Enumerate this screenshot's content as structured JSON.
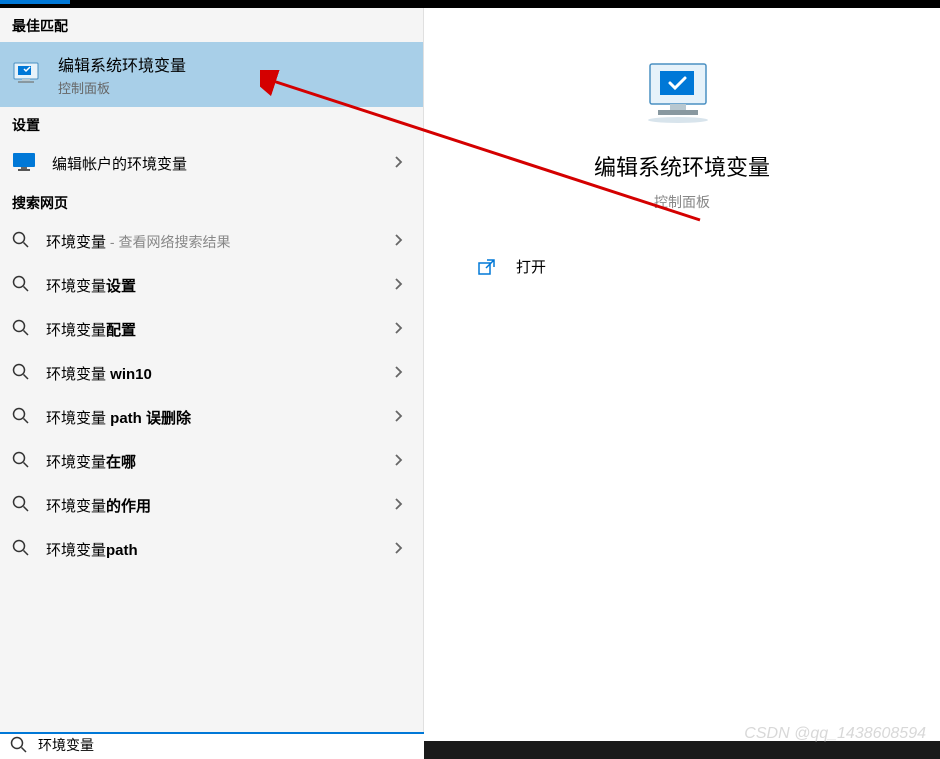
{
  "sections": {
    "best_match": "最佳匹配",
    "settings": "设置",
    "web_search": "搜索网页"
  },
  "best_match_item": {
    "title": "编辑系统环境变量",
    "subtitle": "控制面板"
  },
  "settings_item": {
    "title": "编辑帐户的环境变量"
  },
  "web_items": [
    {
      "prefix": "环境变量",
      "suffix": "",
      "hint": " - 查看网络搜索结果"
    },
    {
      "prefix": "环境变量",
      "suffix": "设置",
      "hint": ""
    },
    {
      "prefix": "环境变量",
      "suffix": "配置",
      "hint": ""
    },
    {
      "prefix": "环境变量 ",
      "suffix": "win10",
      "hint": ""
    },
    {
      "prefix": "环境变量 ",
      "suffix": "path 误删除",
      "hint": ""
    },
    {
      "prefix": "环境变量",
      "suffix": "在哪",
      "hint": ""
    },
    {
      "prefix": "环境变量",
      "suffix": "的作用",
      "hint": ""
    },
    {
      "prefix": "环境变量",
      "suffix": "path",
      "hint": ""
    }
  ],
  "detail": {
    "title": "编辑系统环境变量",
    "subtitle": "控制面板",
    "open_label": "打开"
  },
  "search_input": "环境变量",
  "watermark": "CSDN @qq_1438608594"
}
